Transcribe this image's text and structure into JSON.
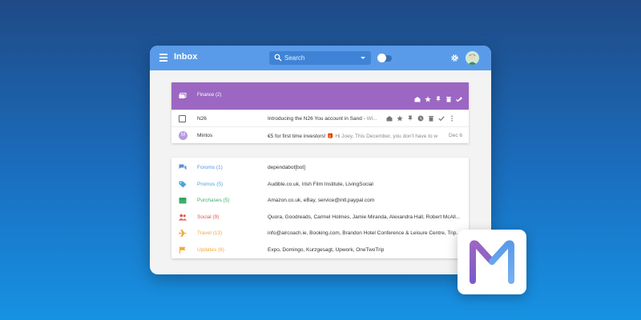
{
  "header": {
    "title": "Inbox",
    "search_placeholder": "Search"
  },
  "group": {
    "title": "Finance (2)",
    "color": "#9b67c3"
  },
  "emails": [
    {
      "sender": "N26",
      "subject": "Introducing the N26 You account in Sand - ",
      "preview": "Wi...",
      "date": ""
    },
    {
      "sender": "Mintos",
      "avatar_letter": "M",
      "subject": "€5 for first time investors! 🎁 ",
      "preview": "Hi Joey, This December, you don't have to w",
      "date": "Dec 6"
    }
  ],
  "categories": [
    {
      "label": "Forums (1)",
      "color": "#5a8fe0",
      "icon": "forum-icon",
      "senders": "dependabot[bot]"
    },
    {
      "label": "Promos (5)",
      "color": "#4aa6d8",
      "icon": "tag-icon",
      "senders": "Audible.co.uk, Irish Film Institute, LivingSocial"
    },
    {
      "label": "Purchases (5)",
      "color": "#3fae6b",
      "icon": "purchase-icon",
      "senders": "Amazon.co.uk, eBay, service@intl.paypal.com"
    },
    {
      "label": "Social (9)",
      "color": "#e0574b",
      "icon": "people-icon",
      "senders": "Quora, Goodreads, Carmel Holmes, Jamie Miranda, Alexandra Hall, Robert McAll..."
    },
    {
      "label": "Travel (13)",
      "color": "#f2a93b",
      "icon": "plane-icon",
      "senders": "info@aircoach.ie, Booking.com, Brandon Hotel Conference & Leisure Centre, Trip..."
    },
    {
      "label": "Updates (6)",
      "color": "#f2a93b",
      "icon": "flag-icon",
      "senders": "Expo, Domingo, Kurzgesagt, Upwork, OneTwoTrip"
    }
  ],
  "colors": {
    "topbar": "#5a9be9",
    "accent_purple": "#9b67c3"
  }
}
